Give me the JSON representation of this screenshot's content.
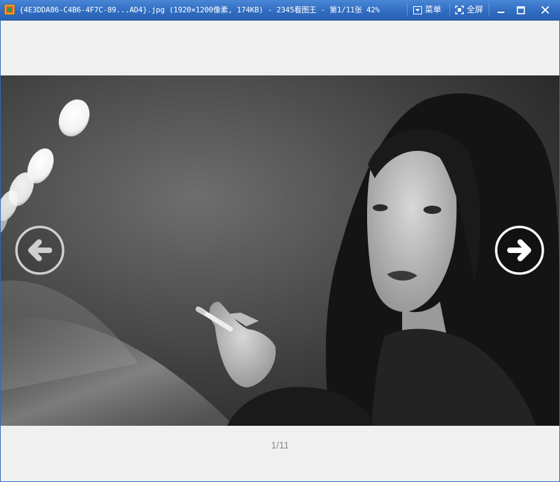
{
  "window": {
    "title": "{4E3DDA86-C4B6-4F7C-89...AD4}.jpg (1920×1200像素, 174KB) - 2345看图王 - 第1/11张 42%",
    "menu_label": "菜单",
    "fullscreen_label": "全屏"
  },
  "viewer": {
    "counter": "1/11",
    "current_index": 1,
    "total": 11,
    "zoom_percent": 42
  },
  "colors": {
    "titlebar": "#2f6bbf",
    "background": "#f0f0f0",
    "counter_text": "#8a8a8a"
  },
  "icons": {
    "app": "app-icon",
    "menu": "menu-icon",
    "fullscreen": "fullscreen-icon",
    "minimize": "minimize-icon",
    "maximize": "maximize-icon",
    "close": "close-icon",
    "prev": "arrow-left-icon",
    "next": "arrow-right-icon"
  }
}
